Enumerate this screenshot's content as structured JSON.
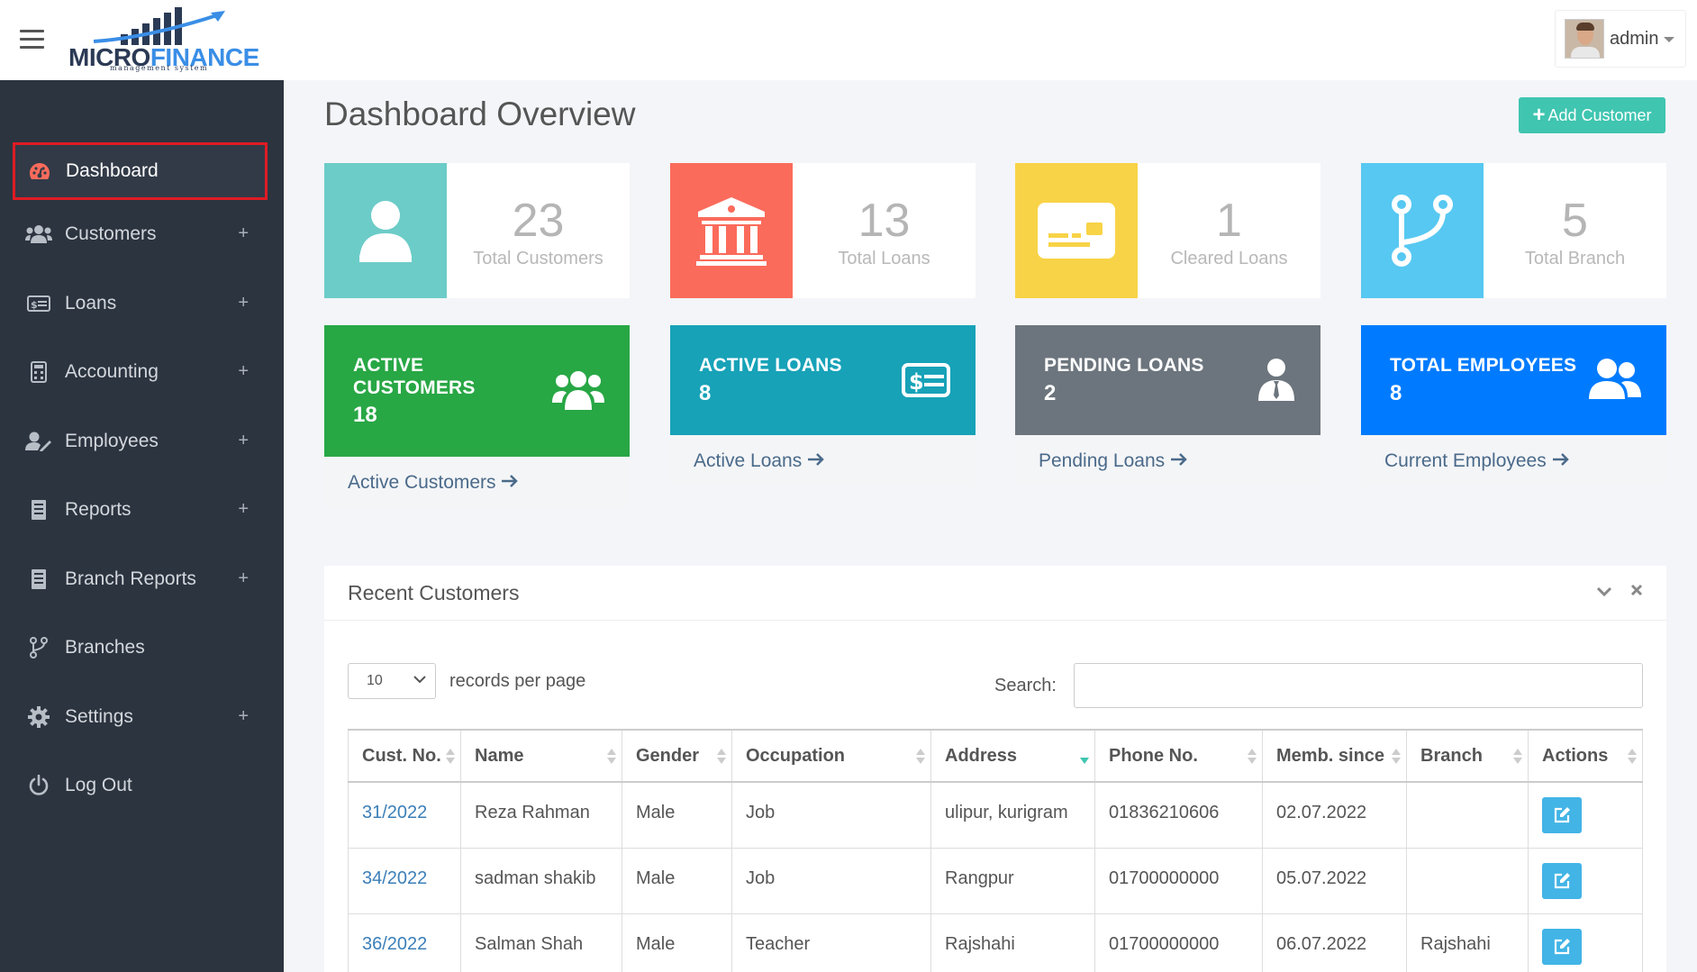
{
  "app": {
    "logo_primary": "MICRO",
    "logo_secondary": "FINANCE",
    "logo_sub": "management system",
    "user_name": "admin"
  },
  "sidebar": {
    "items": [
      {
        "label": "Dashboard",
        "icon": "dashboard-icon",
        "expandable": false,
        "active": true
      },
      {
        "label": "Customers",
        "icon": "users-icon",
        "expandable": true
      },
      {
        "label": "Loans",
        "icon": "money-bill-icon",
        "expandable": true
      },
      {
        "label": "Accounting",
        "icon": "calculator-icon",
        "expandable": true
      },
      {
        "label": "Employees",
        "icon": "user-edit-icon",
        "expandable": true
      },
      {
        "label": "Reports",
        "icon": "report-icon",
        "expandable": true
      },
      {
        "label": "Branch Reports",
        "icon": "report-icon",
        "expandable": true
      },
      {
        "label": "Branches",
        "icon": "code-branch-icon",
        "expandable": false
      },
      {
        "label": "Settings",
        "icon": "gear-icon",
        "expandable": true
      },
      {
        "label": "Log Out",
        "icon": "power-icon",
        "expandable": false
      }
    ],
    "expand_symbol": "+"
  },
  "main": {
    "title": "Dashboard Overview",
    "add_button": "Add Customer",
    "add_button_symbol": "+",
    "stats": [
      {
        "value": "23",
        "label": "Total Customers",
        "color": "#6cccc8",
        "icon": "user-icon"
      },
      {
        "value": "13",
        "label": "Total Loans",
        "color": "#fb6b5b",
        "icon": "bank-icon"
      },
      {
        "value": "1",
        "label": "Cleared Loans",
        "color": "#f8d347",
        "icon": "card-icon"
      },
      {
        "value": "5",
        "label": "Total Branch",
        "color": "#57c8f2",
        "icon": "code-branch-icon"
      }
    ],
    "cards": [
      {
        "title_line1": "ACTIVE",
        "title_line2": "CUSTOMERS",
        "value": "18",
        "link": "Active Customers",
        "color": "#28a745",
        "icon": "users-icon"
      },
      {
        "title_line1": "ACTIVE LOANS",
        "title_line2": "",
        "value": "8",
        "link": "Active Loans",
        "color": "#17a2b8",
        "icon": "money-bill-icon"
      },
      {
        "title_line1": "PENDING LOANS",
        "title_line2": "",
        "value": "2",
        "link": "Pending Loans",
        "color": "#6c757d",
        "icon": "user-tie-icon"
      },
      {
        "title_line1": "TOTAL EMPLOYEES",
        "title_line2": "",
        "value": "8",
        "link": "Current Employees",
        "color": "#007bff",
        "icon": "user-friends-icon"
      }
    ]
  },
  "recent": {
    "title": "Recent Customers",
    "per_page_value": "10",
    "per_page_label": "records per page",
    "search_label": "Search:",
    "search_value": "",
    "columns": [
      "Cust. No.",
      "Name",
      "Gender",
      "Occupation",
      "Address",
      "Phone No.",
      "Memb. since",
      "Branch",
      "Actions"
    ],
    "rows": [
      [
        "31/2022",
        "Reza Rahman",
        "Male",
        "Job",
        "ulipur, kurigram",
        "01836210606",
        "02.07.2022",
        ""
      ],
      [
        "34/2022",
        "sadman shakib",
        "Male",
        "Job",
        "Rangpur",
        "01700000000",
        "05.07.2022",
        ""
      ],
      [
        "36/2022",
        "Salman Shah",
        "Male",
        "Teacher",
        "Rajshahi",
        "01700000000",
        "06.07.2022",
        "Rajshahi"
      ]
    ]
  }
}
